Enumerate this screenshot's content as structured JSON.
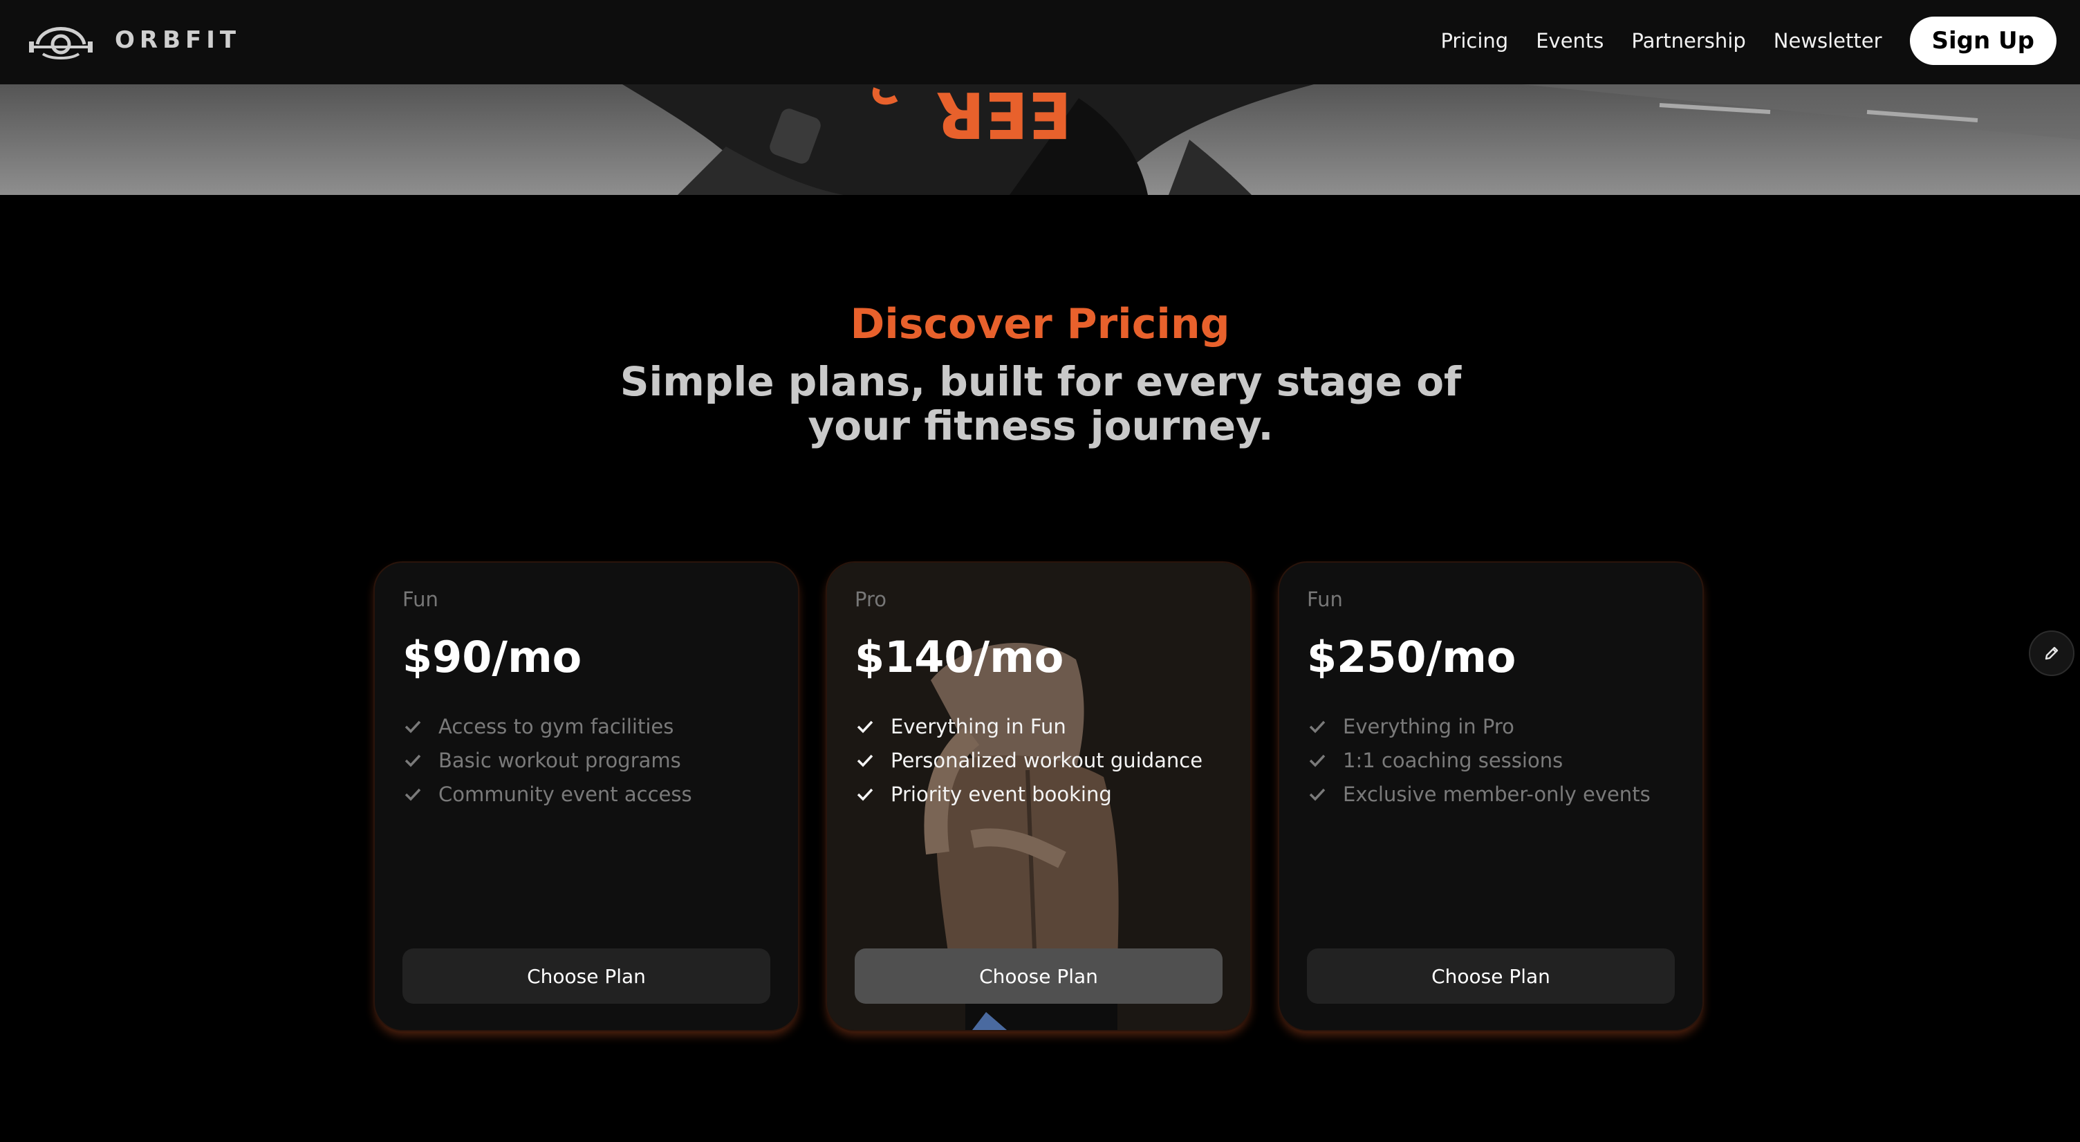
{
  "brand": {
    "name": "ORBFIT",
    "logo_icon": "dumbbell-orb-icon"
  },
  "nav": {
    "links": [
      "Pricing",
      "Events",
      "Partnership",
      "Newsletter"
    ],
    "signup_label": "Sign Up"
  },
  "hero": {
    "image": "athlete-photo-grayscale",
    "overlay_text": "EER"
  },
  "pricing": {
    "eyebrow": "Discover Pricing",
    "headline": "Simple plans, built for every stage of your fitness journey.",
    "plans": [
      {
        "tier": "Fun",
        "price": "$90/mo",
        "features": [
          "Access to gym facilities",
          "Basic workout programs",
          "Community event access"
        ],
        "button": "Choose Plan"
      },
      {
        "tier": "Pro",
        "price": "$140/mo",
        "features": [
          "Everything in Fun",
          "Personalized workout guidance",
          "Priority event booking"
        ],
        "button": "Choose Plan",
        "background": "athlete-back-photo"
      },
      {
        "tier": "Fun",
        "price": "$250/mo",
        "features": [
          "Everything in Pro",
          "1:1 coaching sessions",
          "Exclusive member-only events"
        ],
        "button": "Choose Plan"
      }
    ]
  },
  "fab": {
    "icon": "pencil-icon"
  },
  "colors": {
    "accent": "#e8612c",
    "background": "#000000",
    "nav": "#0d0d0d",
    "card": "#0f0f0f"
  }
}
